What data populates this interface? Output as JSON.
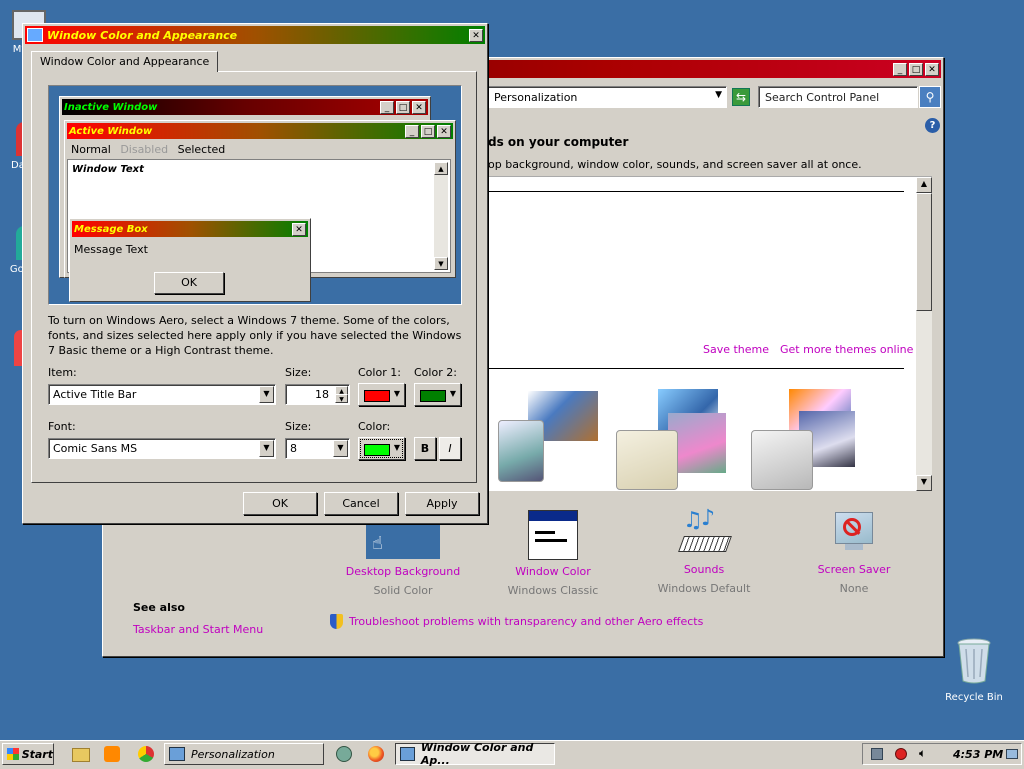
{
  "desktop": {
    "icons": [
      {
        "label": "My",
        "icon": "computer-icon"
      },
      {
        "label": "Data",
        "icon": "data-icon"
      },
      {
        "label": "Goog",
        "icon": "chrome-icon"
      },
      {
        "label": "Recycle Bin",
        "icon": "recycle-bin-icon"
      }
    ]
  },
  "personalization": {
    "address": "Personalization",
    "search_placeholder": "Search Control Panel",
    "heading": "ds on your computer",
    "subheading": "op background, window color, sounds, and screen saver all at once.",
    "save_theme": "Save theme",
    "get_more_themes": "Get more themes online",
    "bottom_items": [
      {
        "title": "Desktop Background",
        "sub": "Solid Color"
      },
      {
        "title": "Window Color",
        "sub": "Windows Classic"
      },
      {
        "title": "Sounds",
        "sub": "Windows Default"
      },
      {
        "title": "Screen Saver",
        "sub": "None"
      }
    ],
    "see_also": "See also",
    "taskbar_link": "Taskbar and Start Menu",
    "troubleshoot_link": "Troubleshoot problems with transparency and other Aero effects"
  },
  "dialog": {
    "title": "Window Color and Appearance",
    "tab": "Window Color and Appearance",
    "preview": {
      "inactive": "Inactive Window",
      "active": "Active Window",
      "menu_normal": "Normal",
      "menu_disabled": "Disabled",
      "menu_selected": "Selected",
      "window_text": "Window Text",
      "msgbox_title": "Message Box",
      "msgbox_text": "Message Text",
      "msgbox_ok": "OK"
    },
    "info": "To turn on Windows Aero, select a Windows 7 theme.  Some of the colors, fonts, and sizes selected here apply only if you have selected the Windows 7 Basic theme or a High Contrast theme.",
    "item_label": "Item:",
    "item_value": "Active Title Bar",
    "size_label": "Size:",
    "size_value": "18",
    "color1_label": "Color 1:",
    "color2_label": "Color 2:",
    "color1": "#ff0000",
    "color2": "#008000",
    "font_label": "Font:",
    "font_value": "Comic Sans MS",
    "font_size_label": "Size:",
    "font_size_value": "8",
    "font_color_label": "Color:",
    "font_color": "#00ff00",
    "bold": "B",
    "italic": "I",
    "ok": "OK",
    "cancel": "Cancel",
    "apply": "Apply"
  },
  "taskbar": {
    "start": "Start",
    "tasks": [
      "Personalization",
      "Window Color and Ap..."
    ],
    "clock": "4:53 PM"
  }
}
